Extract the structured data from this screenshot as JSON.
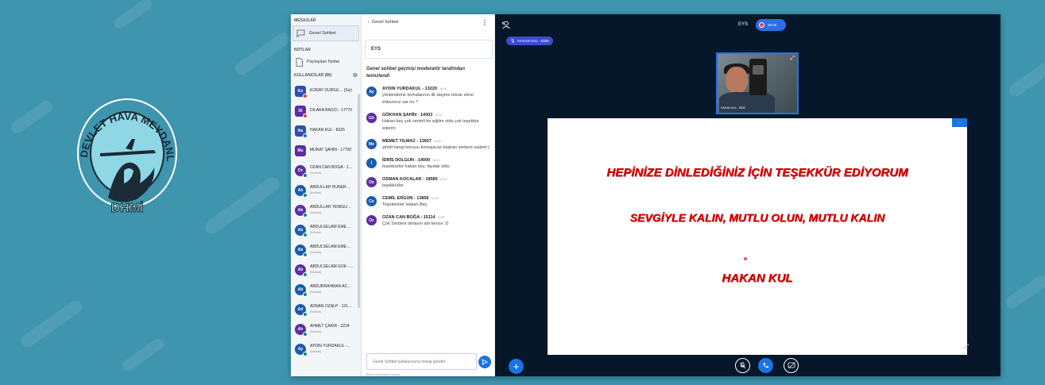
{
  "logo": {
    "arc_text": "DEVLET HAVA MEYDANLARI İŞLETMESİ",
    "monogram": "DHMİ"
  },
  "left_panel": {
    "messages_title": "MESAJLAR",
    "public_chat": "Genel Sohbet",
    "notes_title": "NOTLAR",
    "shared_notes": "Paylaşılan Notlar",
    "users_title": "KULLANICILAR (86)",
    "users": [
      {
        "initials": "Ko",
        "name": "KORAY DURSU… (Siz)",
        "sub": "",
        "color": "#2f4fb5",
        "dot": "#e53935",
        "round": false
      },
      {
        "initials": "DI",
        "name": "DİLARA BAĞCI - 17770",
        "sub": "",
        "color": "#5e2ca5",
        "dot": "#e53935",
        "round": false
      },
      {
        "initials": "Ha",
        "name": "HAKAN KUL - 8326",
        "sub": "",
        "color": "#2f4fb5",
        "dot": "#1565c0",
        "round": false
      },
      {
        "initials": "Mu",
        "name": "MURAT ŞAHİN - 17792",
        "sub": "",
        "color": "#5e2ca5",
        "dot": "",
        "round": false
      },
      {
        "initials": "Oz",
        "name": "OZAN CAN BOĞA - 1…",
        "sub": "(Serbest)",
        "color": "#5e2ca5",
        "dot": "#1565c0",
        "round": true
      },
      {
        "initials": "Ab",
        "name": "ABDULLAH HÜNER…",
        "sub": "(Serbest)",
        "color": "#1a5bb0",
        "dot": "#00897b",
        "round": true
      },
      {
        "initials": "Ab",
        "name": "ABDULLAH YENİGÜ…",
        "sub": "(Serbest)",
        "color": "#5e2ca5",
        "dot": "#00897b",
        "round": true
      },
      {
        "initials": "Ab",
        "name": "ABDULSELAM EME…",
        "sub": "(Serbest)",
        "color": "#1a5bb0",
        "dot": "#00897b",
        "round": true
      },
      {
        "initials": "Ab",
        "name": "ABDULSELAM EME…",
        "sub": "(Serbest)",
        "color": "#1a5bb0",
        "dot": "#00897b",
        "round": true
      },
      {
        "initials": "Ab",
        "name": "ABDULSELAM GÖK -…",
        "sub": "(Serbest)",
        "color": "#5e2ca5",
        "dot": "#00897b",
        "round": true
      },
      {
        "initials": "Ab",
        "name": "ABDURRAHMAN AC…",
        "sub": "(Serbest)",
        "color": "#1a5bb0",
        "dot": "#00897b",
        "round": true
      },
      {
        "initials": "Ad",
        "name": "ADNAN ÖZALP - 131…",
        "sub": "(Serbest)",
        "color": "#1a5bb0",
        "dot": "#00897b",
        "round": true
      },
      {
        "initials": "Ah",
        "name": "AHMET ÇAKIR - 2224",
        "sub": "(Serbest)",
        "color": "#5e2ca5",
        "dot": "#00897b",
        "round": true
      },
      {
        "initials": "Ay",
        "name": "AYDIN YURDAKUL -…",
        "sub": "(Serbest)",
        "color": "#1a5bb0",
        "dot": "#00897b",
        "round": true
      }
    ]
  },
  "chat": {
    "back_label": "Genel Sohbet",
    "welcome": "EYS",
    "cleared": "Genel sohbet geçmişi moderatör tarafından temizlendi",
    "input_placeholder": "Genel Sohbet kullanıcısına mesaj gönder",
    "typing": "Birden çok kullanıcı yazıyor",
    "messages": [
      {
        "initials": "Ay",
        "color": "#1a5bb0",
        "name": "AYDIN YURDAKUL - 13220",
        "time": "16:44",
        "text": "yönlendirme levhalarının ilk slaytını tekrar etme imkanınız var mı ?"
      },
      {
        "initials": "Gö",
        "color": "#5e2ca5",
        "name": "GÖKHAN ŞAHİN - 14003",
        "time": "16:44",
        "text": "Hakan bey çok verimli bir eğitim oldu çok teşekkür ederim"
      },
      {
        "initials": "Me",
        "color": "#1a5bb0",
        "name": "MEMET YILMAZ - 13927",
        "time": "16:44",
        "text": "şimdi hangi konuyu konuşacaz başkan serbest saatmi:)"
      },
      {
        "initials": "İ",
        "color": "#1a5bb0",
        "name": "İDRİS DOLGUN - 14000",
        "time": "16:44",
        "text": "teşekkürler hakan bey. faydalı oldu"
      },
      {
        "initials": "Os",
        "color": "#5e2ca5",
        "name": "OSMAN KOCALAR - 18585",
        "time": "16:45",
        "text": "teşekkürler"
      },
      {
        "initials": "Ce",
        "color": "#1a5bb0",
        "name": "CEMİL ERGÜN - 13856",
        "time": "16:45",
        "text": "Teşekkürler Hakan Bey"
      },
      {
        "initials": "Oz",
        "color": "#5e2ca5",
        "name": "OZAN CAN BOĞA - 15114",
        "time": "16:45",
        "text": "Çok Serbest olmasın abi bence :D"
      }
    ]
  },
  "main": {
    "room_title": "EYS",
    "recording": "00:00",
    "talker": "HAKAN KUL - 8326",
    "webcam_name": "HAKAN KUL - 8326",
    "slide_lines": [
      "HEPİNİZE DİNLEDİĞİNİZ İÇİN TEŞEKKÜR EDİYORUM",
      "SEVGİYLE KALIN, MUTLU OLUN, MUTLU KALIN",
      "HAKAN KUL"
    ]
  }
}
